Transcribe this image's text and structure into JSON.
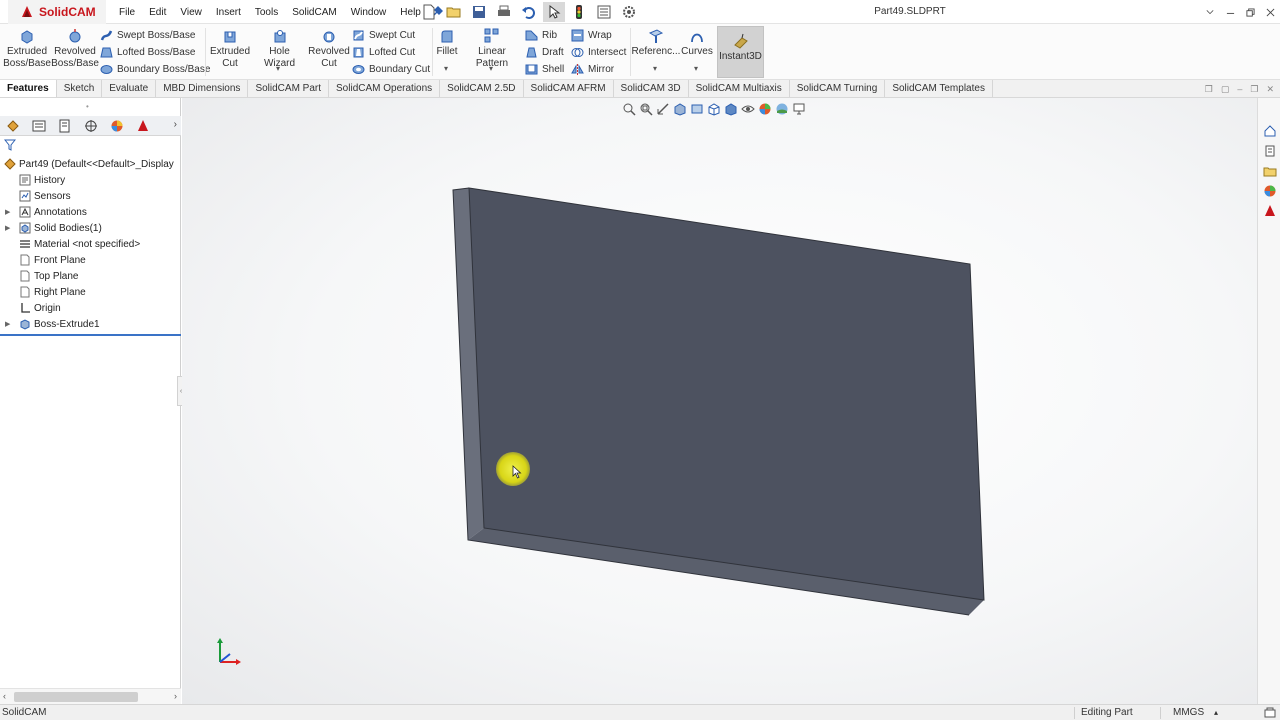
{
  "app": {
    "brand": "SolidCAM",
    "document_title": "Part49.SLDPRT"
  },
  "menu": [
    "File",
    "Edit",
    "View",
    "Insert",
    "Tools",
    "SolidCAM",
    "Window",
    "Help"
  ],
  "ribbon": {
    "extruded_boss": "Extruded\nBoss/Base",
    "revolved_boss": "Revolved\nBoss/Base",
    "swept_boss": "Swept Boss/Base",
    "lofted_boss": "Lofted Boss/Base",
    "boundary_boss": "Boundary Boss/Base",
    "extruded_cut": "Extruded\nCut",
    "hole_wizard": "Hole Wizard",
    "revolved_cut": "Revolved\nCut",
    "swept_cut": "Swept Cut",
    "lofted_cut": "Lofted Cut",
    "boundary_cut": "Boundary Cut",
    "fillet": "Fillet",
    "linear_pattern": "Linear Pattern",
    "rib": "Rib",
    "draft": "Draft",
    "shell": "Shell",
    "wrap": "Wrap",
    "intersect": "Intersect",
    "mirror": "Mirror",
    "reference": "Referenc...",
    "curves": "Curves",
    "instant3d": "Instant3D"
  },
  "tabs": [
    {
      "label": "Features",
      "active": true
    },
    {
      "label": "Sketch",
      "active": false
    },
    {
      "label": "Evaluate",
      "active": false
    },
    {
      "label": "MBD Dimensions",
      "active": false
    },
    {
      "label": "SolidCAM Part",
      "active": false
    },
    {
      "label": "SolidCAM Operations",
      "active": false
    },
    {
      "label": "SolidCAM 2.5D",
      "active": false
    },
    {
      "label": "SolidCAM AFRM",
      "active": false
    },
    {
      "label": "SolidCAM 3D",
      "active": false
    },
    {
      "label": "SolidCAM Multiaxis",
      "active": false
    },
    {
      "label": "SolidCAM Turning",
      "active": false
    },
    {
      "label": "SolidCAM Templates",
      "active": false
    }
  ],
  "tree": {
    "root": "Part49  (Default<<Default>_Display",
    "items": [
      {
        "label": "History",
        "icon": "history-icon",
        "expandable": false
      },
      {
        "label": "Sensors",
        "icon": "sensors-icon",
        "expandable": false
      },
      {
        "label": "Annotations",
        "icon": "annotations-icon",
        "expandable": true
      },
      {
        "label": "Solid Bodies(1)",
        "icon": "solid-bodies-icon",
        "expandable": true
      },
      {
        "label": "Material <not specified>",
        "icon": "material-icon",
        "expandable": false
      },
      {
        "label": "Front Plane",
        "icon": "plane-icon",
        "expandable": false
      },
      {
        "label": "Top Plane",
        "icon": "plane-icon",
        "expandable": false
      },
      {
        "label": "Right Plane",
        "icon": "plane-icon",
        "expandable": false
      },
      {
        "label": "Origin",
        "icon": "origin-icon",
        "expandable": false
      },
      {
        "label": "Boss-Extrude1",
        "icon": "extrude-icon",
        "expandable": true
      }
    ]
  },
  "status": {
    "left": "SolidCAM",
    "mode": "Editing Part",
    "units": "MMGS"
  },
  "colors": {
    "brand_red": "#c8161d",
    "model_face": "#4d5260",
    "model_side": "#6a6f7c",
    "model_bottom": "#5a5f6c",
    "selection_blue": "#3a73c7"
  }
}
